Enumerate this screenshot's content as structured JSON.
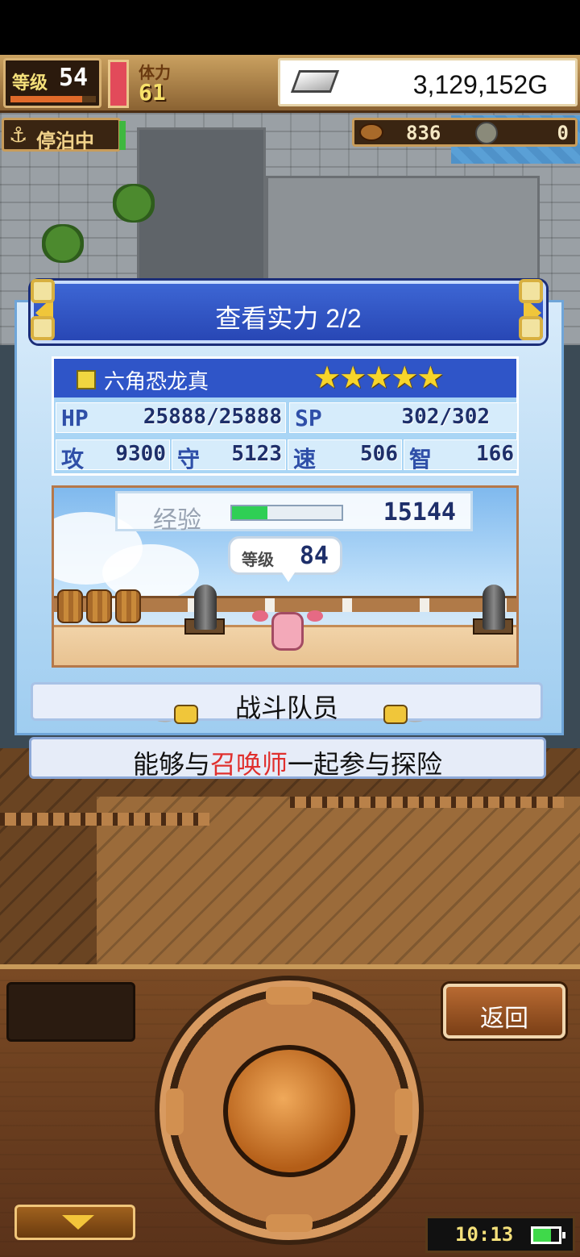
{
  "hud": {
    "level_label": "等级",
    "level_value": "54",
    "stamina_label": "体力",
    "stamina_value": "61",
    "gold_value": "3,129,152G",
    "port_status": "停泊中",
    "food_value": "836",
    "coin_value": "0"
  },
  "dialog": {
    "title": "查看实力 2/2",
    "monster": {
      "name": "六角恐龙真",
      "stars": [
        "★",
        "★",
        "★",
        "★",
        "★"
      ],
      "hp_label": "HP",
      "hp_value": "25888/25888",
      "sp_label": "SP",
      "sp_value": "302/302",
      "atk_label": "攻",
      "atk_value": "9300",
      "def_label": "守",
      "def_value": "5123",
      "spd_label": "速",
      "spd_value": "506",
      "int_label": "智",
      "int_value": "166"
    },
    "exp_label": "经验",
    "exp_value": "15144",
    "level_label": "等级",
    "level_value": "84",
    "party_label": "战斗队员",
    "description_before": "能够与",
    "description_highlight": "召唤师",
    "description_after": "一起参与探险"
  },
  "controls": {
    "back_label": "返回",
    "clock": "10:13"
  },
  "colors": {
    "dialog_header": "#2f4fc0",
    "highlight_text": "#e0302e",
    "star": "#f7d52a",
    "exp_fill": "#2fcf55"
  },
  "icons": [
    "anchor-icon",
    "silver-bar-icon",
    "food-icon",
    "coin-icon",
    "element-icon",
    "battery-icon"
  ]
}
